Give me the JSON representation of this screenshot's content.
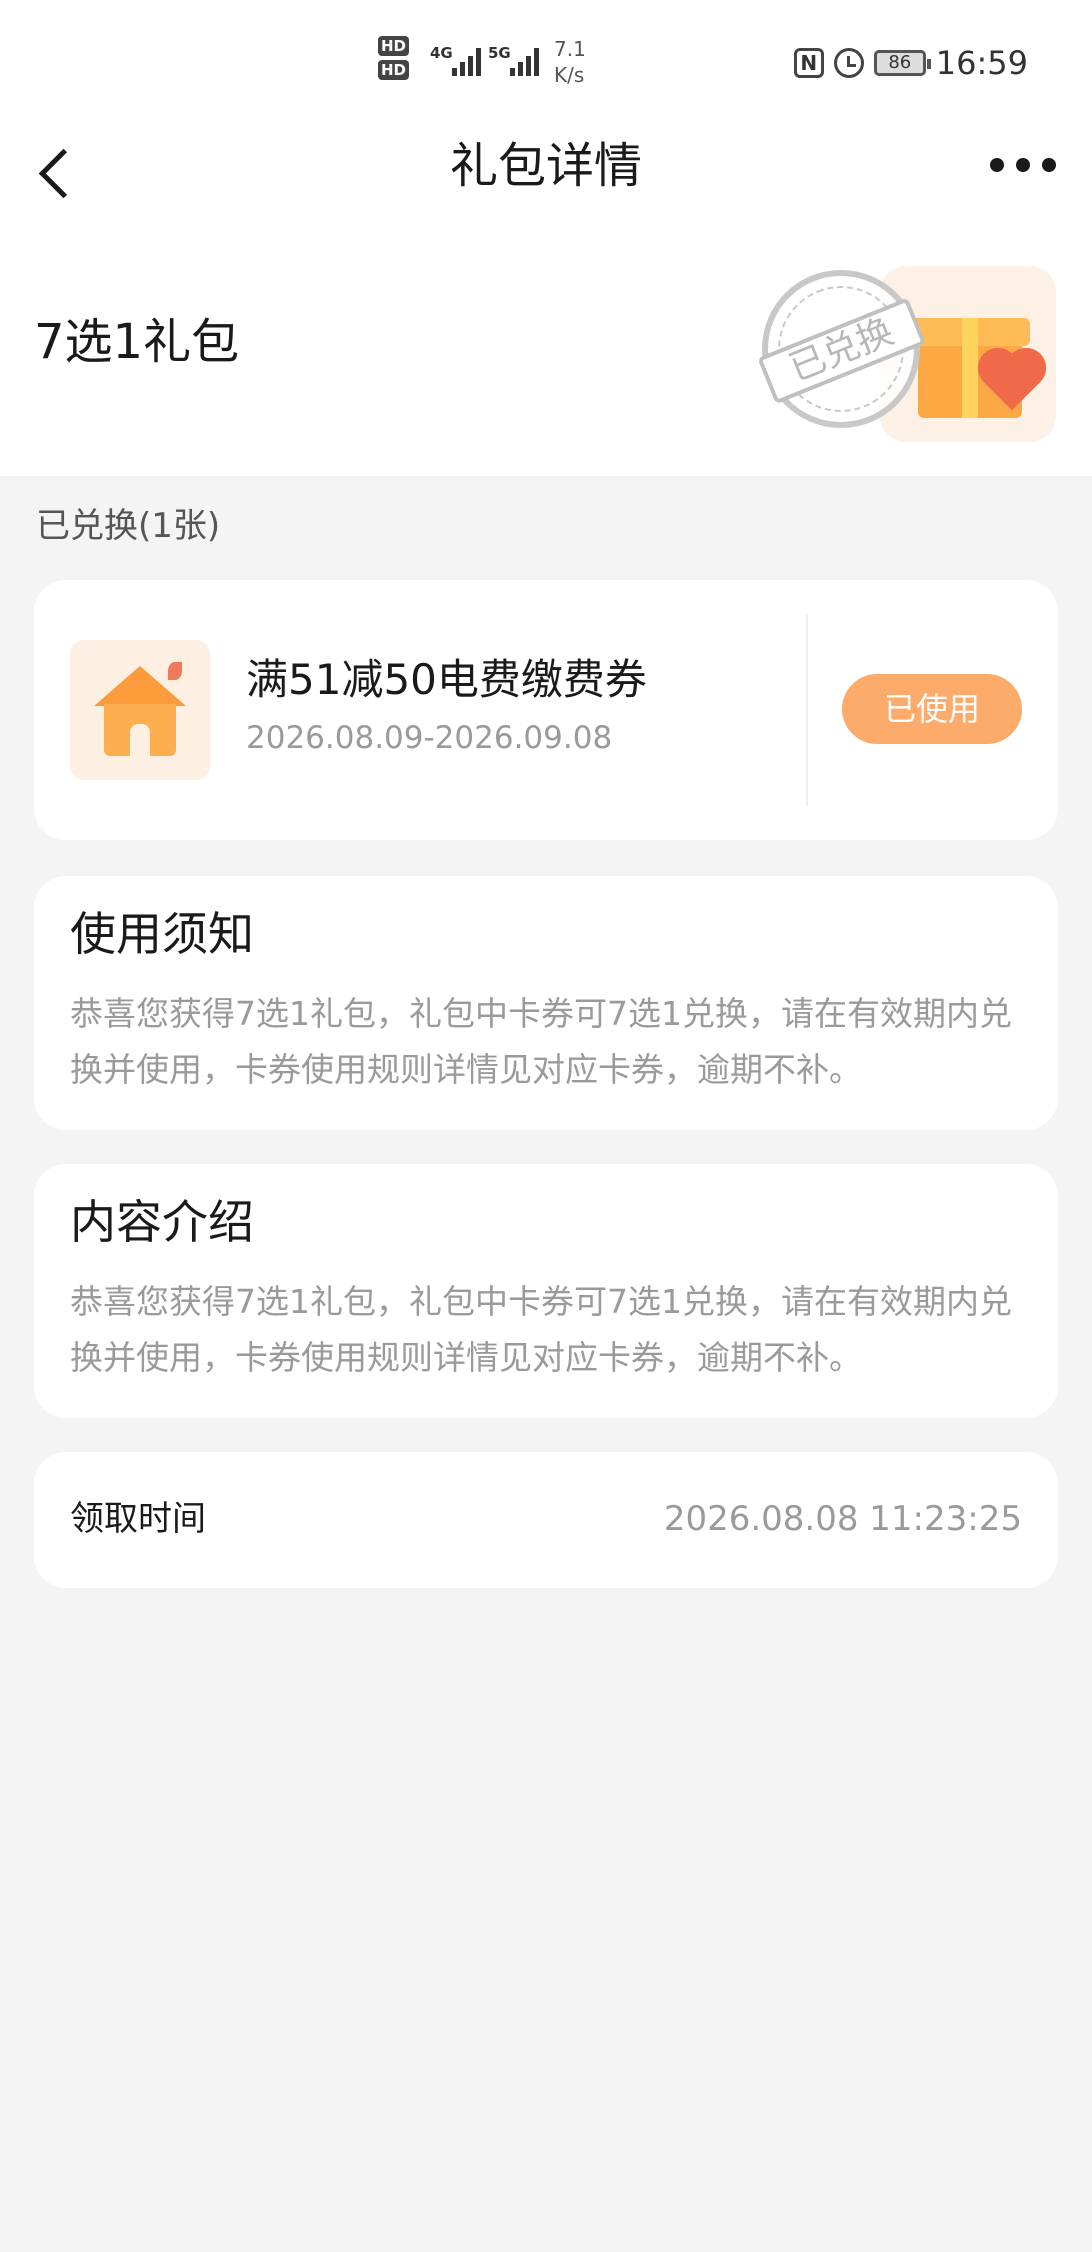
{
  "status_bar": {
    "hd1": "HD",
    "hd2": "HD",
    "net1": "4G",
    "net2": "5G",
    "speed_value": "7.1",
    "speed_unit": "K/s",
    "nfc_glyph": "N",
    "battery": "86",
    "time": "16:59"
  },
  "nav": {
    "title": "礼包详情",
    "back_icon": "chevron-left-icon",
    "more_icon": "more-horizontal-icon"
  },
  "package": {
    "title": "7选1礼包",
    "stamp_text": "已兑换"
  },
  "redeemed_label": "已兑换(1张)",
  "coupon": {
    "name": "满51减50电费缴费券",
    "validity": "2026.08.09-2026.09.08",
    "status_button": "已使用"
  },
  "notice": {
    "title": "使用须知",
    "body": "恭喜您获得7选1礼包，礼包中卡券可7选1兑换，请在有效期内兑换并使用，卡券使用规则详情见对应卡券，逾期不补。"
  },
  "intro": {
    "title": "内容介绍",
    "body": "恭喜您获得7选1礼包，礼包中卡券可7选1兑换，请在有效期内兑换并使用，卡券使用规则详情见对应卡券，逾期不补。"
  },
  "receive_time": {
    "label": "领取时间",
    "value": "2026.08.08 11:23:25"
  },
  "colors": {
    "accent": "#fdab6b",
    "background": "#f4f4f4",
    "card": "#ffffff",
    "muted_text": "#9a9a9a"
  }
}
